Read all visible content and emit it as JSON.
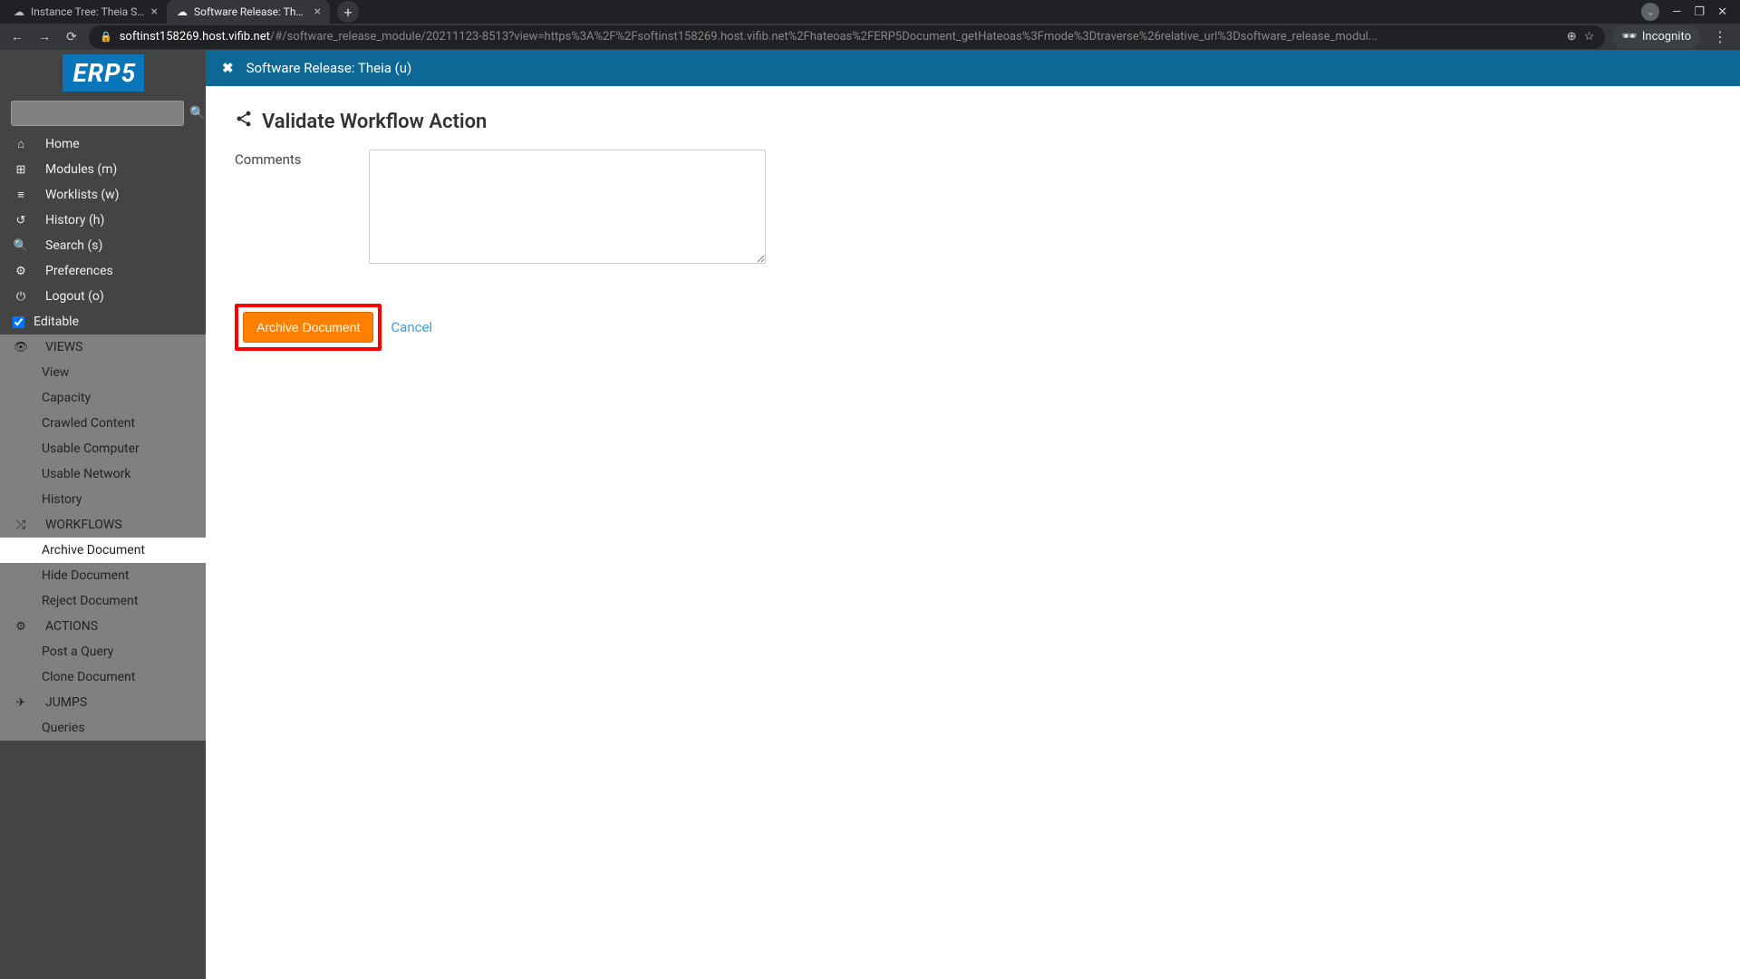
{
  "browser": {
    "tabs": [
      {
        "title": "Instance Tree: Theia Servi"
      },
      {
        "title": "Software Release: Theia"
      }
    ],
    "url_host": "softinst158269.host.vifib.net",
    "url_path": "/#/software_release_module/20211123-8513?view=https%3A%2F%2Fsoftinst158269.host.vifib.net%2Fhateoas%2FERP5Document_getHateoas%3Fmode%3Dtraverse%26relative_url%3Dsoftware_release_modul...",
    "incognito_label": "Incognito"
  },
  "logo": "ERP5",
  "sidebar": {
    "main": [
      {
        "icon": "⌂",
        "label": "Home"
      },
      {
        "icon": "⊞",
        "label": "Modules (m)"
      },
      {
        "icon": "≡",
        "label": "Worklists (w)"
      },
      {
        "icon": "↺",
        "label": "History (h)"
      },
      {
        "icon": "🔍",
        "label": "Search (s)"
      },
      {
        "icon": "⚙",
        "label": "Preferences"
      },
      {
        "icon": "⏻",
        "label": "Logout (o)"
      }
    ],
    "editable_label": "Editable",
    "views": {
      "header": "VIEWS",
      "items": [
        "View",
        "Capacity",
        "Crawled Content",
        "Usable Computer",
        "Usable Network",
        "History"
      ]
    },
    "workflows": {
      "header": "WORKFLOWS",
      "items": [
        "Archive Document",
        "Hide Document",
        "Reject Document"
      ]
    },
    "actions": {
      "header": "ACTIONS",
      "items": [
        "Post a Query",
        "Clone Document"
      ]
    },
    "jumps": {
      "header": "JUMPS",
      "items": [
        "Queries"
      ]
    }
  },
  "header": {
    "title": "Software Release: Theia (u)"
  },
  "main": {
    "title": "Validate Workflow Action",
    "comments_label": "Comments",
    "submit_label": "Archive Document",
    "cancel_label": "Cancel"
  }
}
